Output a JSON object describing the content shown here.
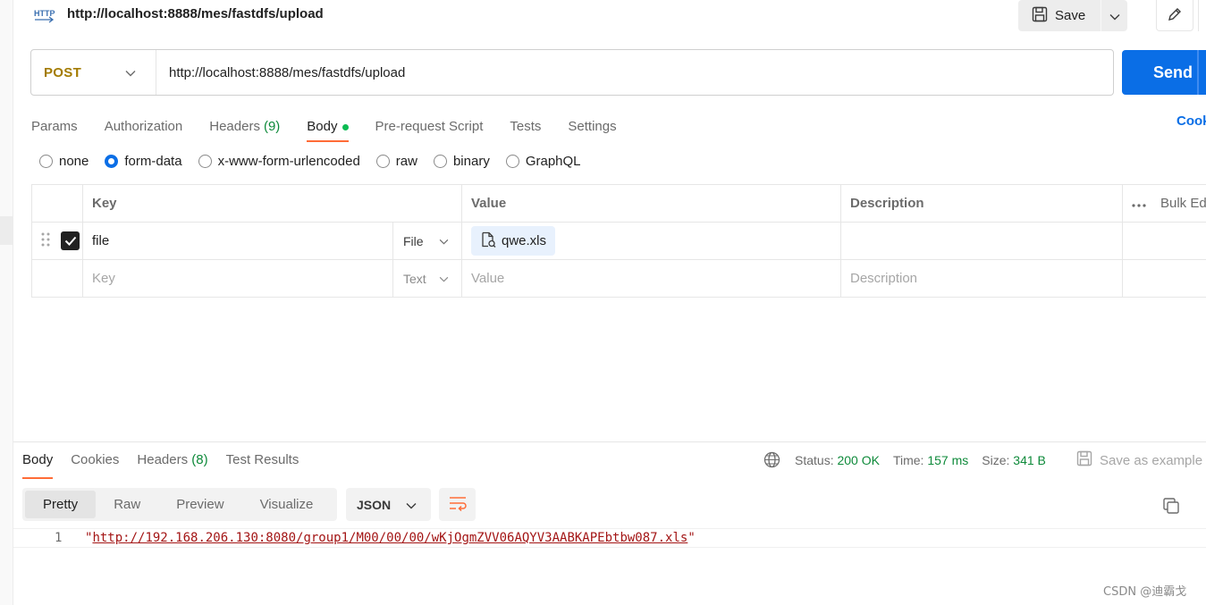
{
  "header": {
    "request_title": "http://localhost:8888/mes/fastdfs/upload",
    "save_label": "Save"
  },
  "urlbar": {
    "method": "POST",
    "url": "http://localhost:8888/mes/fastdfs/upload",
    "send_label": "Send"
  },
  "request_tabs": [
    {
      "label": "Params"
    },
    {
      "label": "Authorization"
    },
    {
      "label": "Headers",
      "count": "(9)"
    },
    {
      "label": "Body",
      "active": true
    },
    {
      "label": "Pre-request Script"
    },
    {
      "label": "Tests"
    },
    {
      "label": "Settings"
    }
  ],
  "cookies_link": "Cookies",
  "body_types": [
    "none",
    "form-data",
    "x-www-form-urlencoded",
    "raw",
    "binary",
    "GraphQL"
  ],
  "body_type_selected": "form-data",
  "table": {
    "headers": {
      "key": "Key",
      "value": "Value",
      "description": "Description",
      "bulk_edit": "Bulk Edit"
    },
    "rows": [
      {
        "checked": true,
        "key": "file",
        "type": "File",
        "value": "qwe.xls",
        "description": ""
      }
    ],
    "placeholder": {
      "key": "Key",
      "type": "Text",
      "value": "Value",
      "description": "Description"
    }
  },
  "response": {
    "tabs": [
      {
        "label": "Body",
        "active": true
      },
      {
        "label": "Cookies"
      },
      {
        "label": "Headers",
        "count": "(8)"
      },
      {
        "label": "Test Results"
      }
    ],
    "status_label": "Status:",
    "status_value": "200 OK",
    "time_label": "Time:",
    "time_value": "157 ms",
    "size_label": "Size:",
    "size_value": "341 B",
    "save_example": "Save as example",
    "view_tabs": [
      "Pretty",
      "Raw",
      "Preview",
      "Visualize"
    ],
    "format": "JSON",
    "lines": [
      {
        "no": "1",
        "text": "http://192.168.206.130:8080/group1/M00/00/00/wKjOgmZVV06AQYV3AABKAPEbtbw087.xls"
      }
    ]
  },
  "watermark": "CSDN @迪霸戈",
  "colors": {
    "accent": "#0a6ee6",
    "method": "#a37b00",
    "tab_underline": "#ff6c37",
    "status_ok": "#0e8a3a",
    "string": "#a31515"
  }
}
